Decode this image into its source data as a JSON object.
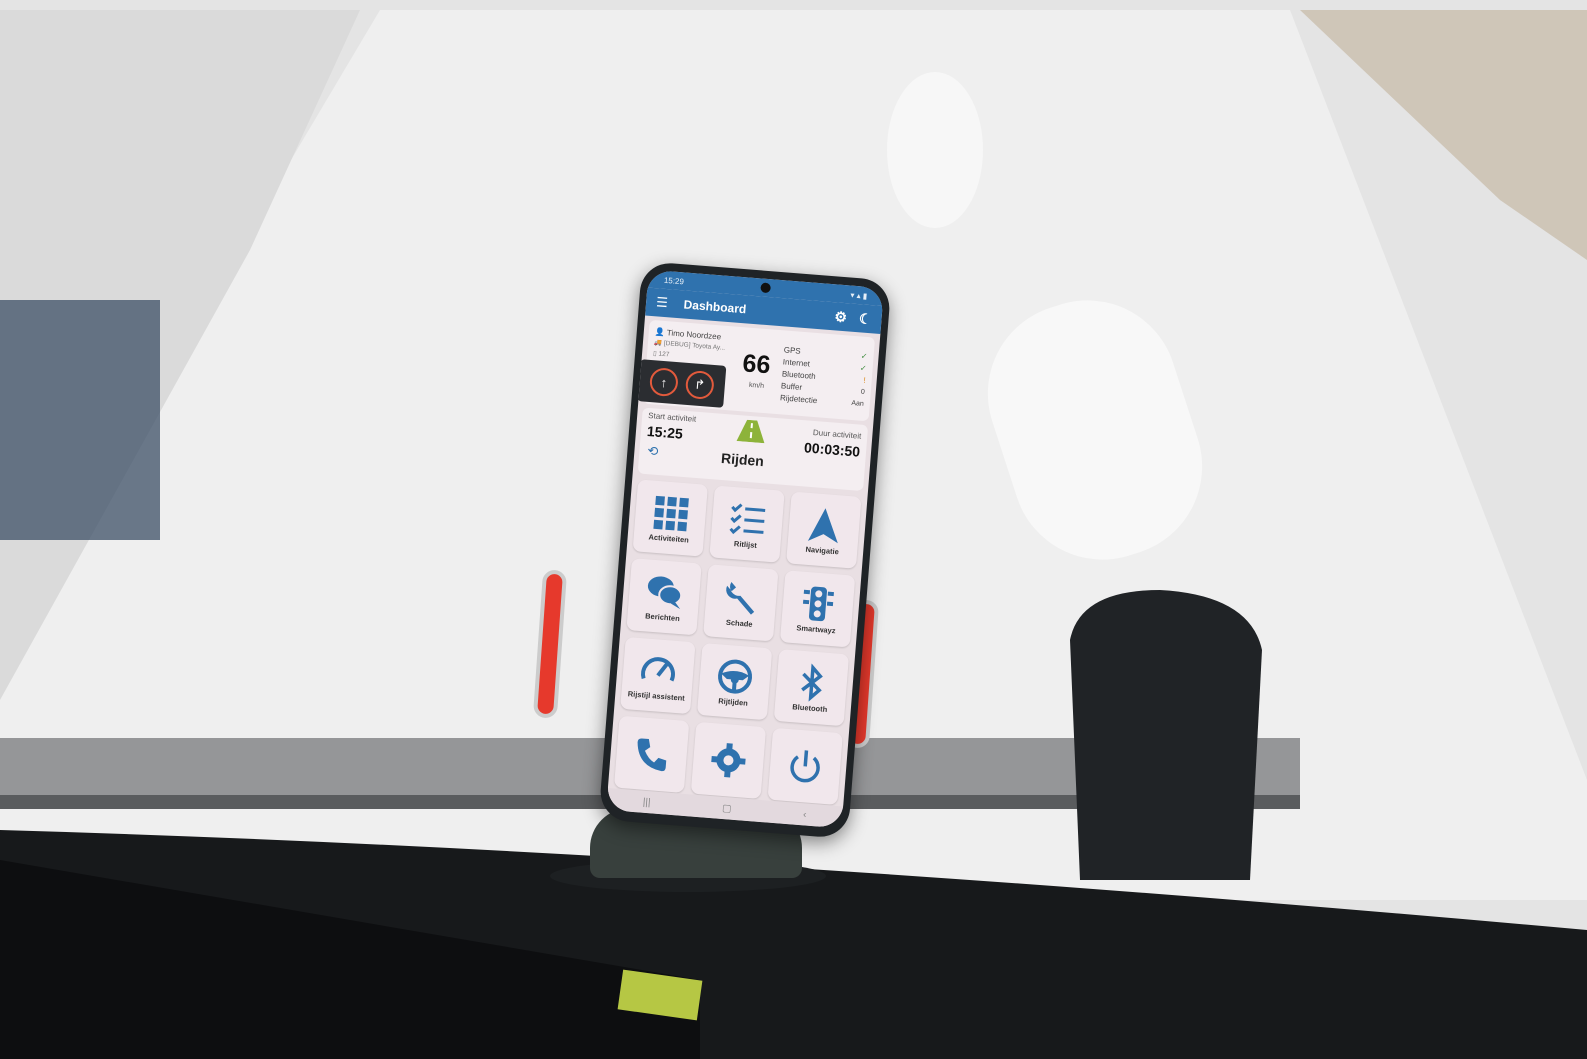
{
  "status_bar": {
    "time": "15:29",
    "icons": "signal-icons"
  },
  "app_bar": {
    "title": "Dashboard",
    "menu_icon": "menu-icon",
    "settings_icon": "gear-icon",
    "theme_icon": "moon-icon"
  },
  "driver": {
    "name": "Timo Noordzee",
    "vehicle": "[DEBUG] Toyota Ay...",
    "device": "127"
  },
  "speed": {
    "value": "66",
    "unit": "km/h"
  },
  "status": {
    "items": [
      {
        "label": "GPS",
        "value": "✓",
        "state": "ok"
      },
      {
        "label": "Internet",
        "value": "✓",
        "state": "ok"
      },
      {
        "label": "Bluetooth",
        "value": "!",
        "state": "warn"
      },
      {
        "label": "Buffer",
        "value": "0",
        "state": "num"
      },
      {
        "label": "Rijdetectie",
        "value": "Aan",
        "state": "num"
      }
    ]
  },
  "activity": {
    "start_label": "Start activiteit",
    "start_time": "15:25",
    "name": "Rijden",
    "duration_label": "Duur activiteit",
    "duration": "00:03:50"
  },
  "tiles": [
    {
      "label": "Activiteiten",
      "icon": "grid-icon"
    },
    {
      "label": "Ritlijst",
      "icon": "checklist-icon"
    },
    {
      "label": "Navigatie",
      "icon": "navigation-arrow-icon"
    },
    {
      "label": "Berichten",
      "icon": "chat-bubbles-icon"
    },
    {
      "label": "Schade",
      "icon": "wrench-icon"
    },
    {
      "label": "Smartwayz",
      "icon": "traffic-light-icon"
    },
    {
      "label": "Rijstijl assistent",
      "icon": "gauge-icon"
    },
    {
      "label": "Rijtijden",
      "icon": "steering-wheel-icon"
    },
    {
      "label": "Bluetooth",
      "icon": "bluetooth-icon"
    },
    {
      "label": "",
      "icon": "phone-icon"
    },
    {
      "label": "",
      "icon": "gear-icon"
    },
    {
      "label": "",
      "icon": "power-icon"
    }
  ],
  "colors": {
    "accent": "#2f72ae",
    "screen_bg": "#e9dfe3",
    "tile_bg": "#f1e7ec",
    "clip_red": "#e6392c",
    "road_green": "#8db33a"
  }
}
